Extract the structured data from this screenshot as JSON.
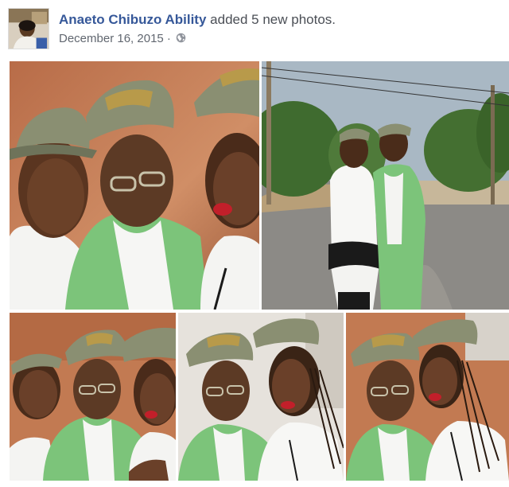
{
  "post": {
    "author_name": "Anaeto Chibuzo Ability",
    "action_text": "added 5 new photos.",
    "date": "December 16, 2015",
    "separator": "·",
    "privacy_icon": "globe-icon"
  },
  "photos": [
    {
      "id": "photo-1",
      "scene": "indoor-selfie-three-people"
    },
    {
      "id": "photo-2",
      "scene": "outdoor-road-couple-standing"
    },
    {
      "id": "photo-3",
      "scene": "indoor-selfie-three-people"
    },
    {
      "id": "photo-4",
      "scene": "indoor-selfie-two-people"
    },
    {
      "id": "photo-5",
      "scene": "indoor-selfie-two-people"
    }
  ],
  "colors": {
    "author_link": "#365899",
    "text": "#4b4f56",
    "meta": "#616770",
    "uniform_green": "#7fc47a",
    "wall_orange": "#c8825a"
  }
}
